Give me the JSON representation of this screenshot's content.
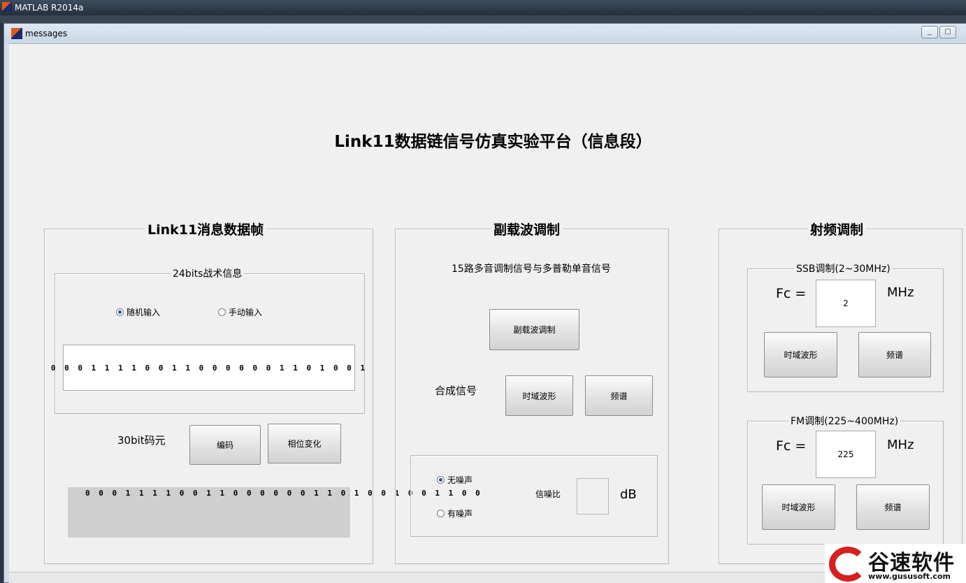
{
  "desktop": {
    "title": "MATLAB R2014a"
  },
  "window": {
    "title": "messages",
    "min_label": "_",
    "max_label": "□"
  },
  "main_title": "Link11数据链信号仿真实验平台（信息段）",
  "panel_frame": {
    "title": "Link11消息数据帧",
    "tactical": {
      "title": "24bits战术信息",
      "radio_random": "随机输入",
      "radio_manual": "手动输入",
      "bits": "0 0 0 1 1 1 1 0 0 1 1 0 0 0 0 0 0 1 1 0 1 0 0 1"
    },
    "code_label": "30bit码元",
    "encode_button": "编码",
    "phase_button": "相位变化",
    "code_bits": "0 0 0 1 1 1 1 0 0 1 1 0 0 0 0 0 0 1 1 0 1 0 0 1 0 0 1 1 0 0"
  },
  "panel_subcarrier": {
    "title": "副载波调制",
    "description": "15路多音调制信号与多普勒单音信号",
    "modulate_button": "副载波调制",
    "composite_label": "合成信号",
    "time_button": "时域波形",
    "spectrum_button": "频谱",
    "noise": {
      "radio_no_noise": "无噪声",
      "radio_noise": "有噪声",
      "snr_label": "信噪比",
      "snr_value": "",
      "snr_unit": "dB"
    }
  },
  "panel_rf": {
    "title": "射频调制",
    "ssb": {
      "title": "SSB调制(2~30MHz)",
      "fc_label": "Fc =",
      "fc_value": "2",
      "unit": "MHz",
      "time_button": "时域波形",
      "spectrum_button": "频谱"
    },
    "fm": {
      "title": "FM调制(225~400MHz)",
      "fc_label": "Fc =",
      "fc_value": "225",
      "unit": "MHz",
      "time_button": "时域波形",
      "spectrum_button": "频谱"
    }
  },
  "watermark": {
    "brand": "谷速软件",
    "url": "www.gususoft.com"
  }
}
